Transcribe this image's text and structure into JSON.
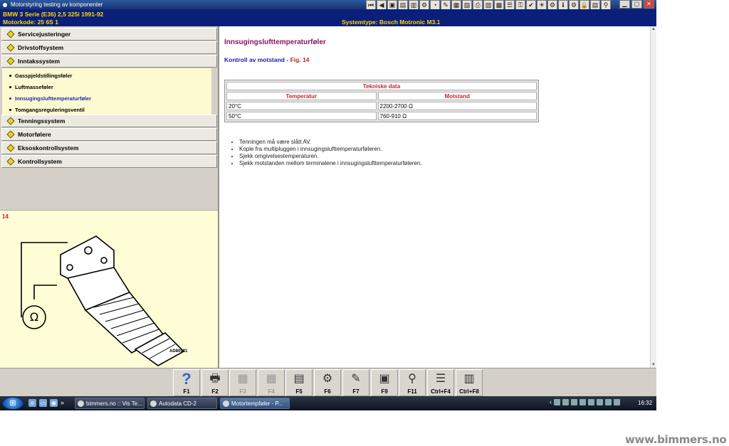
{
  "window": {
    "title": "Motorstyring testing av komponenter",
    "controls": [
      "▁",
      "▢",
      "✕"
    ]
  },
  "toolbar_icons": [
    "first-icon",
    "prev-icon",
    "logo-icon",
    "book-icon",
    "graph-icon",
    "tool-icon",
    "gauge-icon",
    "wrench-icon",
    "notes-icon",
    "doc-icon",
    "print-icon",
    "engine-icon",
    "calc-icon",
    "list-icon",
    "key-icon",
    "check-icon",
    "light-icon",
    "gear-icon",
    "info-icon",
    "gear2-icon",
    "lock-icon",
    "doc2-icon",
    "search-icon"
  ],
  "info": {
    "line1": "BMW   3 Serie (E36) 2,5 325i 1991-92",
    "line2": "Motorkode: 25 6S 1",
    "system": "Systemtype: Bosch Motronic M3.1"
  },
  "nav": {
    "top_items": [
      "Servicejusteringer",
      "Drivstoffsystem",
      "Inntakssystem"
    ],
    "sub_items": [
      "Gasspjeldstillingsføler",
      "Luftmasseføler",
      "Innsugingslufttemperaturføler",
      "Tomgangsreguleringsventil"
    ],
    "active_sub": 2,
    "bottom_items": [
      "Tenningssystem",
      "Motorfølere",
      "Eksoskontrollsystem",
      "Kontrollsystem"
    ]
  },
  "figure": {
    "number": "14",
    "code": "AD80931"
  },
  "content": {
    "heading": "Innsugingslufttemperaturføler",
    "subheading": "Kontroll av motstand - ",
    "fig_ref": "Fig. 14",
    "table": {
      "caption": "Tekniske data",
      "headers": [
        "Temperatur",
        "Motstand"
      ],
      "rows": [
        [
          "20°C",
          "2200-2700 Ω"
        ],
        [
          "50°C",
          "760-910 Ω"
        ]
      ]
    },
    "instructions": [
      "Tenningen må være slått AV.",
      "Kople fra multipluggen i innsugingslufttemperaturføleren.",
      "Sjekk omgivelsestemperaturen.",
      "Sjekk motstanden mellom terminalene i innsugingslufttemperaturføleren."
    ]
  },
  "fkeys": [
    {
      "label": "F1",
      "icon": "?",
      "name": "help-icon",
      "enabled": true
    },
    {
      "label": "F2",
      "icon": "🖶",
      "name": "print-icon",
      "enabled": true
    },
    {
      "label": "F3",
      "icon": "▦",
      "name": "page-icon",
      "enabled": false
    },
    {
      "label": "F4",
      "icon": "▦",
      "name": "page2-icon",
      "enabled": false
    },
    {
      "label": "F5",
      "icon": "▤",
      "name": "notes-icon",
      "enabled": true
    },
    {
      "label": "F6",
      "icon": "⚙",
      "name": "engine-icon",
      "enabled": true
    },
    {
      "label": "F7",
      "icon": "✎",
      "name": "probe-icon",
      "enabled": true
    },
    {
      "label": "F9",
      "icon": "▣",
      "name": "data-icon",
      "enabled": true
    },
    {
      "label": "F11",
      "icon": "⚲",
      "name": "search-icon",
      "enabled": true
    },
    {
      "label": "Ctrl+F4",
      "icon": "☰",
      "name": "list-icon",
      "enabled": true
    },
    {
      "label": "Ctrl+F8",
      "icon": "▥",
      "name": "table-icon",
      "enabled": true
    }
  ],
  "taskbar": {
    "start_icon": "⊞",
    "quick_icons": [
      "ie-icon",
      "desktop-icon",
      "chrome-icon"
    ],
    "overflow": "»",
    "windows": [
      {
        "title": "bimmers.no :: Vis Te...",
        "active": false
      },
      {
        "title": "Autodata CD-2",
        "active": false
      },
      {
        "title": "Motortempføler - P...",
        "active": true
      }
    ],
    "tray_arrow": "‹",
    "clock": "16:32"
  },
  "watermark": "www.bimmers.no",
  "colors": {
    "title_bar": "#1e4590",
    "info_bar": "#0a1f7a",
    "info_text": "#ffd700",
    "heading": "#8a1560",
    "subheading": "#22209e",
    "accent_red": "#c0282b",
    "nav_highlight": "#fdf9d0",
    "figure_bg": "#fefdd6"
  }
}
